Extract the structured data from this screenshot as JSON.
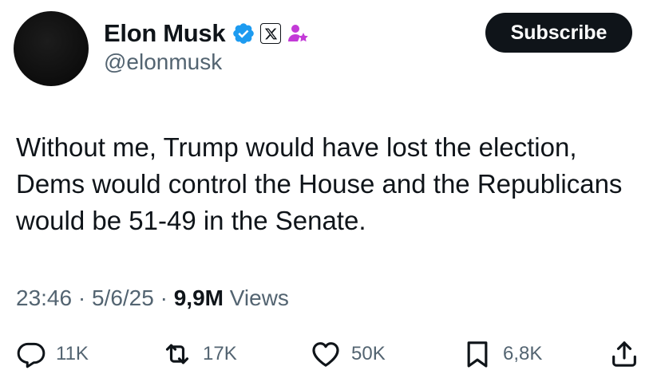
{
  "author": {
    "name": "Elon Musk",
    "handle": "@elonmusk"
  },
  "subscribe_label": "Subscribe",
  "tweet": {
    "text": "Without me, Trump would have lost the election, Dems would control the House and the Republicans would be 51-49 in the Senate."
  },
  "meta": {
    "time": "23:46",
    "dot1": "·",
    "date": "5/6/25",
    "dot2": "·",
    "views_count": "9,9M",
    "views_label": "Views"
  },
  "actions": {
    "replies": "11K",
    "reposts": "17K",
    "likes": "50K",
    "bookmarks": "6,8K"
  },
  "colors": {
    "verified_blue": "#1d9bf0",
    "affiliate_purple": "#c33ad7",
    "secondary_text": "#536471",
    "primary_text": "#0f1419"
  },
  "icons": [
    "verified-badge-icon",
    "x-logo-icon",
    "affiliate-person-star-icon",
    "reply-icon",
    "repost-icon",
    "like-icon",
    "bookmark-icon",
    "share-icon"
  ]
}
